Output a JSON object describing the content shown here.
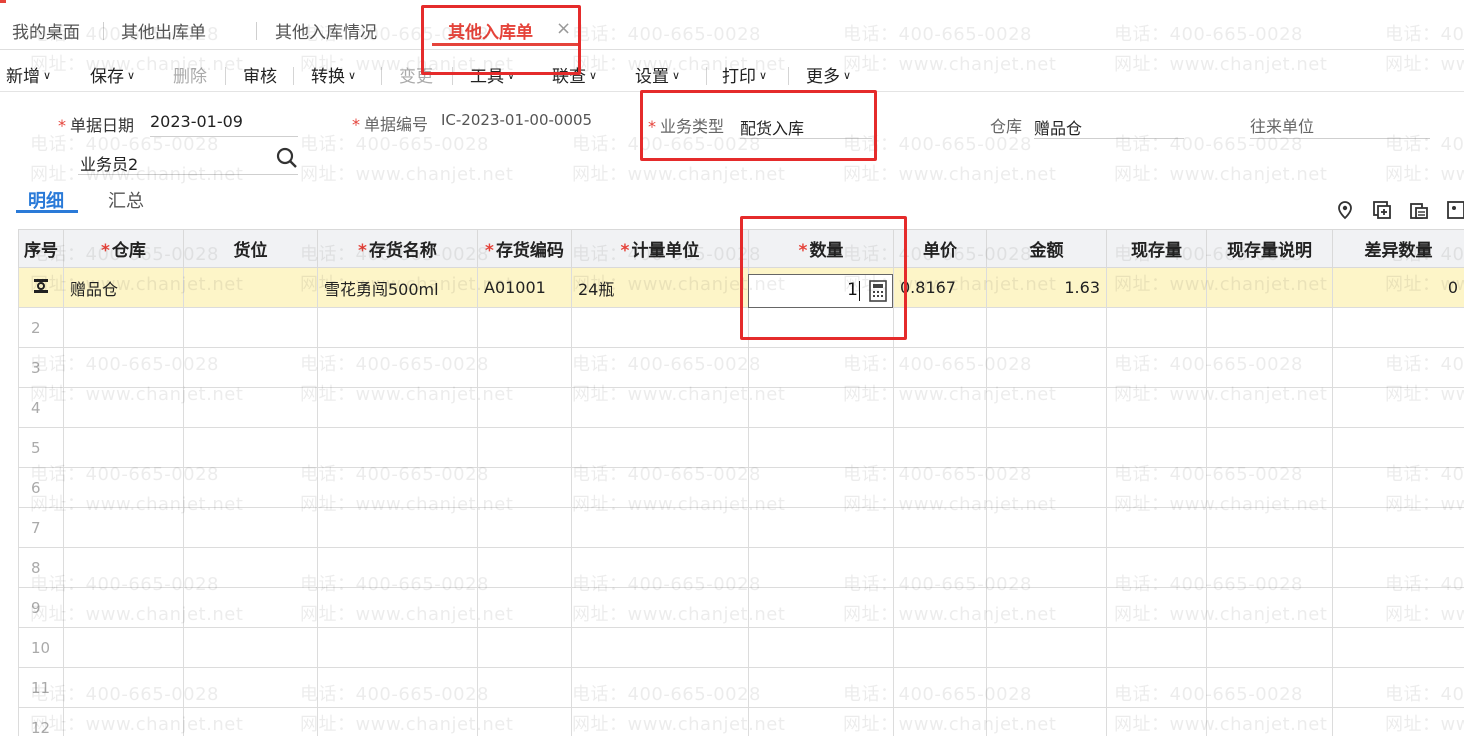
{
  "tabs": [
    {
      "label": "我的桌面"
    },
    {
      "label": "其他出库单"
    },
    {
      "label": "其他入库情况"
    },
    {
      "label": "其他入库单"
    }
  ],
  "tab_close": "×",
  "toolbar": {
    "new": "新增",
    "save": "保存",
    "delete": "删除",
    "audit": "审核",
    "convert": "转换",
    "change": "变更",
    "tools": "工具",
    "query": "联查",
    "settings": "设置",
    "print": "打印",
    "more": "更多"
  },
  "form": {
    "date_label": "单据日期",
    "date_value": "2023-01-09",
    "code_label": "单据编号",
    "code_value": "IC-2023-01-00-0005",
    "biz_type_label": "业务类型",
    "biz_type_value": "配货入库",
    "warehouse_label": "仓库",
    "warehouse_value": "赠品仓",
    "partner_label": "往来单位",
    "salesman_value": "业务员2"
  },
  "detail_tabs": {
    "detail": "明细",
    "summary": "汇总"
  },
  "table": {
    "headers": {
      "seq": "序号",
      "warehouse": "仓库",
      "location": "货位",
      "item_name": "存货名称",
      "item_code": "存货编码",
      "unit": "计量单位",
      "qty": "数量",
      "price": "单价",
      "amount": "金额",
      "stock": "现存量",
      "stock_note": "现存量说明",
      "diff_qty": "差异数量"
    },
    "row1": {
      "warehouse": "赠品仓",
      "item_name": "雪花勇闯500ml",
      "item_code": "A01001",
      "unit": "24瓶",
      "qty": "1",
      "price": "0.8167",
      "amount": "1.63",
      "diff_qty": "0"
    },
    "row_numbers": [
      "2",
      "3",
      "4",
      "5",
      "6",
      "7",
      "8",
      "9",
      "10",
      "11",
      "12"
    ]
  },
  "watermark": {
    "phone": "电话：400-665-0028",
    "site": "网址：www.chanjet.net"
  }
}
